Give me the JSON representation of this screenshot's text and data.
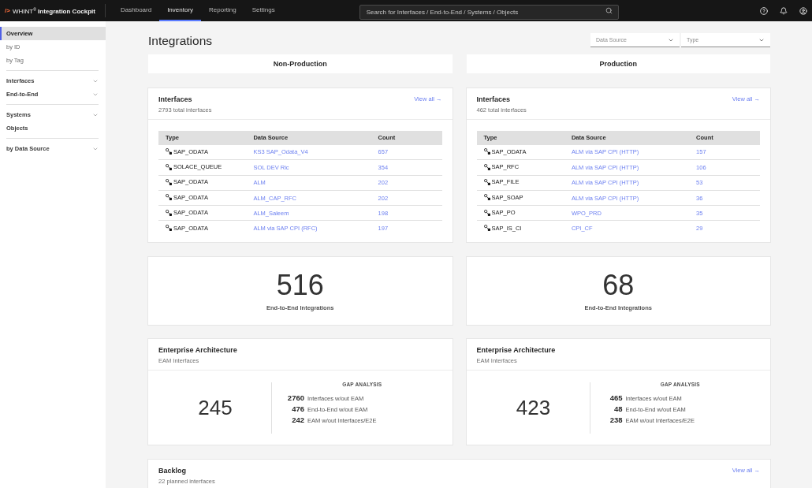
{
  "top_bar": {
    "logo_mark": "/>",
    "app_title": "WHINT$^{®}$ **Integration Cockpit**",
    "nav": [
      {
        "label": "Dashboard",
        "selected": false
      },
      {
        "label": "Inventory",
        "selected": true
      },
      {
        "label": "Reporting",
        "selected": false
      },
      {
        "label": "Settings",
        "selected": false
      }
    ],
    "search": {
      "placeholder": "Search for Interfaces / End-to-End / Systems / Objects"
    }
  },
  "sidebar": {
    "groups": [
      {
        "items": [
          {
            "label": "Overview",
            "kind": "primary",
            "selected": true,
            "expandable": false
          },
          {
            "label": "by ID",
            "kind": "secondary",
            "selected": false,
            "expandable": false
          },
          {
            "label": "by Tag",
            "kind": "secondary",
            "selected": false,
            "expandable": false
          }
        ]
      },
      {
        "items": [
          {
            "label": "Interfaces",
            "kind": "primary",
            "selected": false,
            "expandable": true
          },
          {
            "label": "End-to-End",
            "kind": "primary",
            "selected": false,
            "expandable": true
          }
        ]
      },
      {
        "items": [
          {
            "label": "Systems",
            "kind": "primary",
            "selected": false,
            "expandable": true
          },
          {
            "label": "Objects",
            "kind": "primary",
            "selected": false,
            "expandable": false
          }
        ]
      },
      {
        "items": [
          {
            "label": "by Data Source",
            "kind": "primary",
            "selected": false,
            "expandable": true
          }
        ]
      }
    ]
  },
  "page": {
    "title": "Integrations",
    "filters": [
      {
        "label": "Data Source"
      },
      {
        "label": "Type"
      }
    ]
  },
  "environments": [
    {
      "heading": "Non-Production",
      "interfaces": {
        "title": "Interfaces",
        "subtitle": "2793 total interfaces",
        "view_all": "View all →",
        "columns": [
          "Type",
          "Data Source",
          "Count"
        ],
        "rows": [
          {
            "type": "SAP_ODATA",
            "data_source": "KS3 SAP_Odata_V4",
            "count": "657"
          },
          {
            "type": "SOLACE_QUEUE",
            "data_source": "SOL DEV Ric",
            "count": "354"
          },
          {
            "type": "SAP_ODATA",
            "data_source": "ALM",
            "count": "202"
          },
          {
            "type": "SAP_ODATA",
            "data_source": "ALM_CAP_RFC",
            "count": "202"
          },
          {
            "type": "SAP_ODATA",
            "data_source": "ALM_Saleem",
            "count": "198"
          },
          {
            "type": "SAP_ODATA",
            "data_source": "ALM via SAP CPI (RFC)",
            "count": "197"
          }
        ]
      },
      "end_to_end": {
        "value": "516",
        "label": "End-to-End Integrations"
      },
      "enterprise_architecture": {
        "title": "Enterprise Architecture",
        "subtitle": "EAM Interfaces",
        "value": "245",
        "gap_heading": "GAP ANALYSIS",
        "gaps": [
          {
            "value": "2760",
            "label": "Interfaces w/out EAM"
          },
          {
            "value": "476",
            "label": "End-to-End w/out EAM"
          },
          {
            "value": "242",
            "label": "EAM w/out Interfaces/E2E"
          }
        ]
      }
    },
    {
      "heading": "Production",
      "interfaces": {
        "title": "Interfaces",
        "subtitle": "462 total interfaces",
        "view_all": "View all →",
        "columns": [
          "Type",
          "Data Source",
          "Count"
        ],
        "rows": [
          {
            "type": "SAP_ODATA",
            "data_source": "ALM via SAP CPI (HTTP)",
            "count": "157"
          },
          {
            "type": "SAP_RFC",
            "data_source": "ALM via SAP CPI (HTTP)",
            "count": "106"
          },
          {
            "type": "SAP_FILE",
            "data_source": "ALM via SAP CPI (HTTP)",
            "count": "53"
          },
          {
            "type": "SAP_SOAP",
            "data_source": "ALM via SAP CPI (HTTP)",
            "count": "36"
          },
          {
            "type": "SAP_PO",
            "data_source": "WPO_PRD",
            "count": "35"
          },
          {
            "type": "SAP_IS_CI",
            "data_source": "CPI_CF",
            "count": "29"
          }
        ]
      },
      "end_to_end": {
        "value": "68",
        "label": "End-to-End Integrations"
      },
      "enterprise_architecture": {
        "title": "Enterprise Architecture",
        "subtitle": "EAM Interfaces",
        "value": "423",
        "gap_heading": "GAP ANALYSIS",
        "gaps": [
          {
            "value": "465",
            "label": "Interfaces w/out EAM"
          },
          {
            "value": "48",
            "label": "End-to-End w/out EAM"
          },
          {
            "value": "238",
            "label": "EAM w/out Interfaces/E2E"
          }
        ]
      }
    }
  ],
  "backlog": {
    "title": "Backlog",
    "subtitle": "22 planned interfaces",
    "view_all": "View all →"
  }
}
